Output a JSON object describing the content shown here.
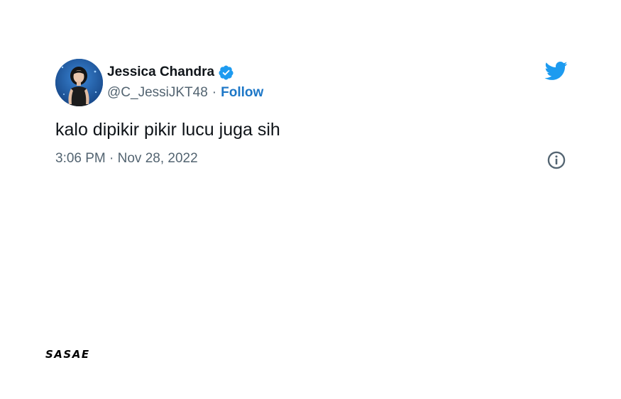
{
  "tweet": {
    "author": {
      "display_name": "Jessica Chandra",
      "handle": "@C_JessiJKT48",
      "verified": true,
      "separator": "·",
      "follow_label": "Follow"
    },
    "text": "kalo dipikir pikir lucu juga sih",
    "timestamp": "3:06 PM · Nov 28, 2022"
  },
  "icons": {
    "logo": "twitter-bird-icon",
    "verified": "verified-badge-icon",
    "info": "info-icon"
  },
  "colors": {
    "twitter_blue": "#1d9bf0",
    "follow_link": "#1d77c7",
    "secondary_text": "#536471",
    "primary_text": "#0f1419"
  },
  "watermark": {
    "text": "SASAE"
  }
}
